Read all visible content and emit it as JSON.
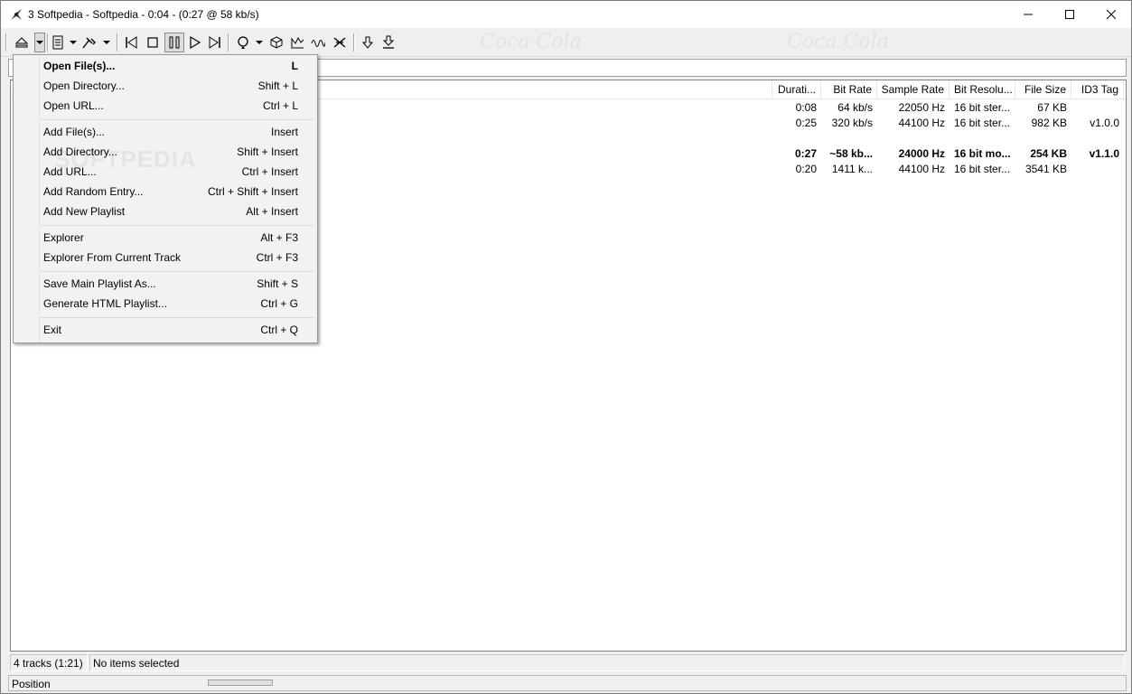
{
  "window": {
    "title": "3 Softpedia - Softpedia - 0:04 - (0:27 @ 58 kb/s)"
  },
  "toolbar": {
    "watermark": "Coca Cola",
    "icons": [
      "eject-icon",
      "chevron-down-icon",
      "playlist-icon",
      "chevron-down-icon",
      "tools-icon",
      "chevron-down-icon",
      "previous-track-icon",
      "stop-icon",
      "pause-icon",
      "play-icon",
      "next-track-icon",
      "repeat-icon",
      "chevron-down-icon",
      "cube-icon",
      "graph-icon",
      "wave-icon",
      "equalizer-icon",
      "down-arrow-icon",
      "download-icon"
    ]
  },
  "columns": [
    "Durati...",
    "Bit Rate",
    "Sample Rate",
    "Bit Resolu...",
    "File Size",
    "ID3 Tag"
  ],
  "rows": [
    {
      "duration": "0:08",
      "bitrate": "64 kb/s",
      "sample_rate": "22050 Hz",
      "bit_res": "16 bit ster...",
      "file_size": "67 KB",
      "id3": ""
    },
    {
      "duration": "0:25",
      "bitrate": "320 kb/s",
      "sample_rate": "44100 Hz",
      "bit_res": "16 bit ster...",
      "file_size": "982 KB",
      "id3": "v1.0.0"
    },
    {
      "duration": "0:27",
      "bitrate": "~58 kb...",
      "sample_rate": "24000 Hz",
      "bit_res": "16 bit mo...",
      "file_size": "254 KB",
      "id3": "v1.1.0",
      "bold": true
    },
    {
      "duration": "0:20",
      "bitrate": "1411 k...",
      "sample_rate": "44100 Hz",
      "bit_res": "16 bit ster...",
      "file_size": "3541 KB",
      "id3": ""
    }
  ],
  "menu": {
    "watermark": "SOFTPEDIA",
    "items": [
      {
        "label": "Open File(s)...",
        "shortcut": "L",
        "default": true
      },
      {
        "label": "Open Directory...",
        "shortcut": "Shift + L"
      },
      {
        "label": "Open URL...",
        "shortcut": "Ctrl + L"
      },
      {
        "sep": true
      },
      {
        "label": "Add File(s)...",
        "shortcut": "Insert"
      },
      {
        "label": "Add Directory...",
        "shortcut": "Shift + Insert"
      },
      {
        "label": "Add URL...",
        "shortcut": "Ctrl + Insert"
      },
      {
        "label": "Add Random Entry...",
        "shortcut": "Ctrl + Shift + Insert"
      },
      {
        "label": "Add New Playlist",
        "shortcut": "Alt + Insert"
      },
      {
        "sep": true
      },
      {
        "label": "Explorer",
        "shortcut": "Alt + F3"
      },
      {
        "label": "Explorer From Current Track",
        "shortcut": "Ctrl + F3"
      },
      {
        "sep": true
      },
      {
        "label": "Save Main Playlist As...",
        "shortcut": "Shift + S"
      },
      {
        "label": "Generate HTML Playlist...",
        "shortcut": "Ctrl + G"
      },
      {
        "sep": true
      },
      {
        "label": "Exit",
        "shortcut": "Ctrl + Q"
      }
    ]
  },
  "status": {
    "tracks": "4 tracks (1:21)",
    "selection": "No items selected",
    "position_label": "Position"
  }
}
